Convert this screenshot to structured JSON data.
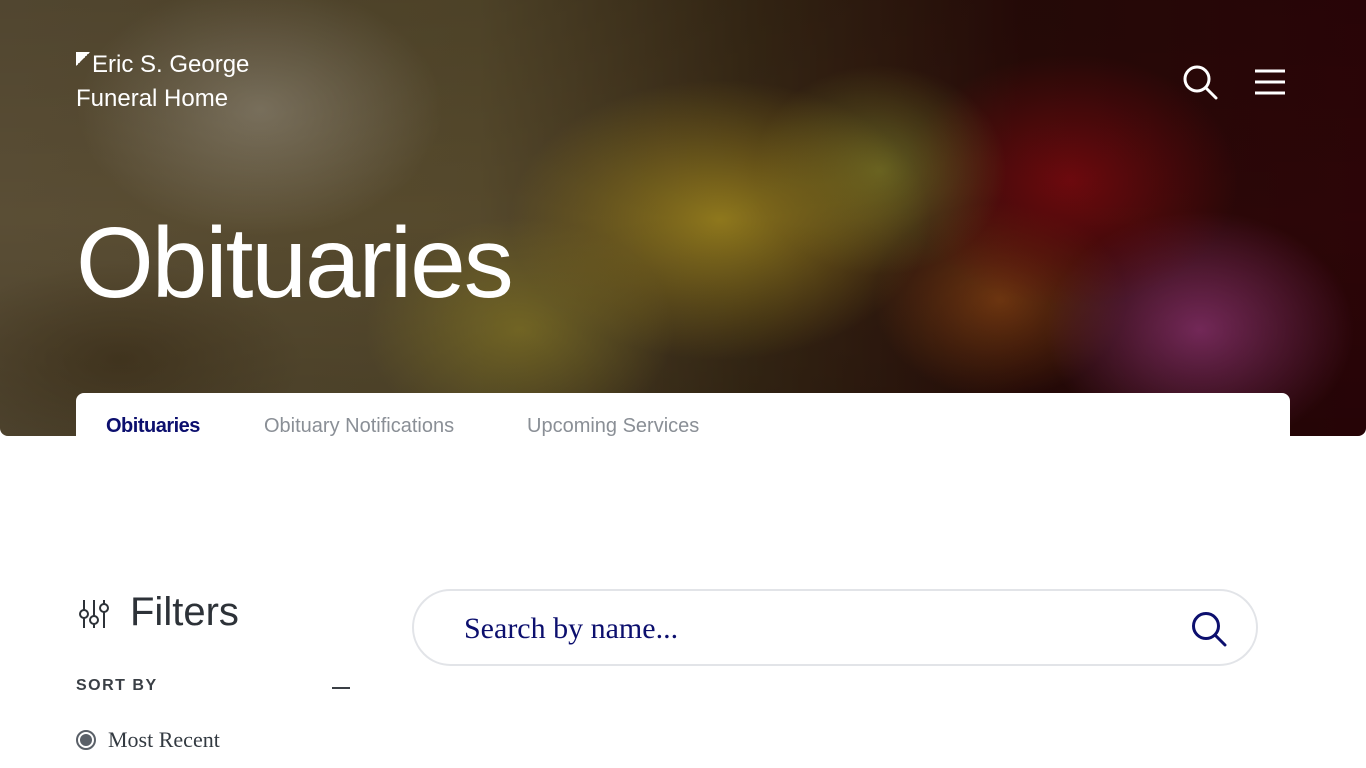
{
  "brand": {
    "logo_text": "Eric S. George Funeral Home"
  },
  "header": {
    "search_icon": "search-icon",
    "menu_icon": "hamburger-menu-icon"
  },
  "hero": {
    "title": "Obituaries"
  },
  "tabs": [
    {
      "label": "Obituaries",
      "active": true
    },
    {
      "label": "Obituary Notifications",
      "active": false
    },
    {
      "label": "Upcoming Services",
      "active": false
    }
  ],
  "filters": {
    "title": "Filters",
    "icon": "sliders-icon",
    "sort_by_label": "SORT BY",
    "sort_options": [
      {
        "label": "Most Recent",
        "selected": true
      }
    ]
  },
  "search": {
    "placeholder": "Search by name...",
    "value": ""
  },
  "colors": {
    "accent": "#0c0f6e",
    "muted_tab": "#8a8f96",
    "text_dark": "#2d3238"
  }
}
